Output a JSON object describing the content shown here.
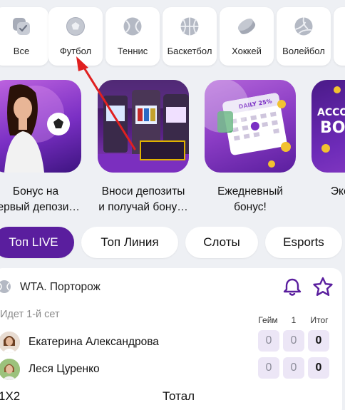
{
  "sports": [
    {
      "label": "Все",
      "icon": "all-sports-icon"
    },
    {
      "label": "Футбол",
      "icon": "football-icon"
    },
    {
      "label": "Теннис",
      "icon": "tennis-icon"
    },
    {
      "label": "Баскетбол",
      "icon": "basketball-icon"
    },
    {
      "label": "Хоккей",
      "icon": "hockey-puck-icon"
    },
    {
      "label": "Волейбол",
      "icon": "volleyball-icon"
    }
  ],
  "promos": [
    {
      "line1": "Бонус на",
      "line2": "первый депози…"
    },
    {
      "line1": "Вноси депозиты",
      "line2": "и получай бону…"
    },
    {
      "line1": "Ежедневный",
      "line2": "бонус!"
    },
    {
      "line1": "Эксп",
      "line2": ""
    }
  ],
  "promo_texts": {
    "daily_tag": "DAILY 25%",
    "account_banner_line1": "ACCO",
    "account_banner_line2": "BO"
  },
  "tabs": [
    {
      "label": "Топ LIVE",
      "active": true
    },
    {
      "label": "Топ Линия",
      "active": false
    },
    {
      "label": "Слоты",
      "active": false
    },
    {
      "label": "Esports",
      "active": false
    }
  ],
  "match": {
    "league": "WTA. Порторож",
    "status": "Идет 1-й сет",
    "columns": {
      "games": "Гейм",
      "set": "1",
      "total": "Итог"
    },
    "players": [
      {
        "name": "Екатерина Александрова",
        "games": "0",
        "set": "0",
        "total": "0"
      },
      {
        "name": "Леся Цуренко",
        "games": "0",
        "set": "0",
        "total": "0"
      }
    ],
    "markets": {
      "one_x_two": "1X2",
      "total": "Тотал"
    }
  },
  "colors": {
    "accent": "#5a1e9e",
    "score_bg": "#ece6f6",
    "background": "#eef0f4",
    "arrow": "#e02020"
  }
}
